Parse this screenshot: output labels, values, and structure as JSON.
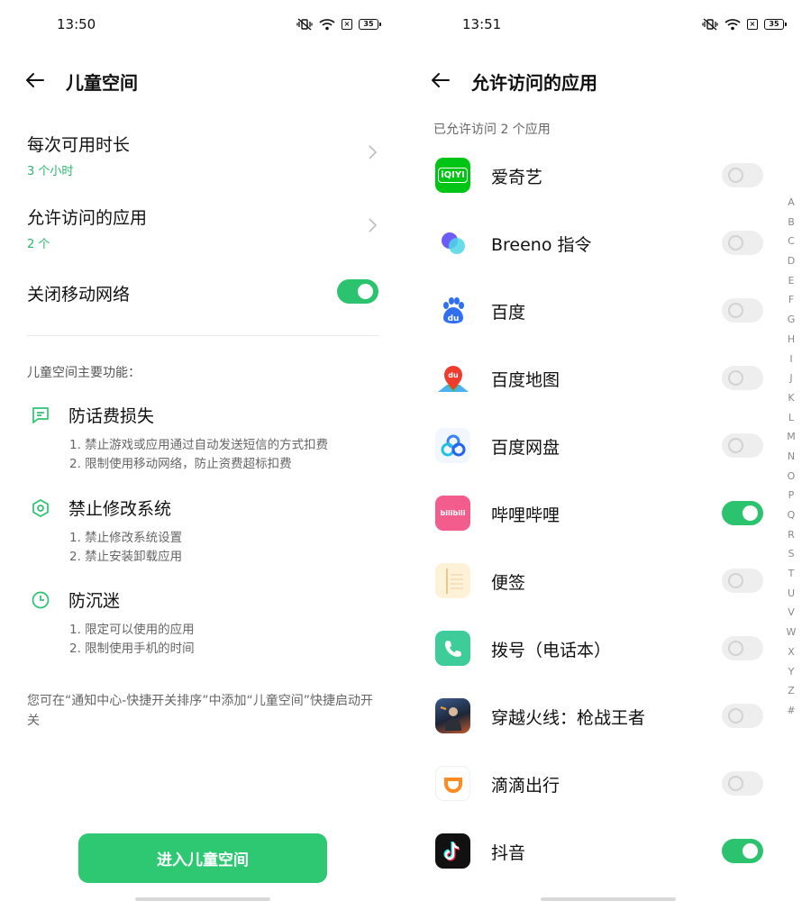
{
  "left": {
    "status_time": "13:50",
    "battery": "35",
    "title": "儿童空间",
    "settings": [
      {
        "title": "每次可用时长",
        "sub": "3 个小时"
      },
      {
        "title": "允许访问的应用",
        "sub": "2 个"
      }
    ],
    "network_toggle": {
      "title": "关闭移动网络",
      "on": true
    },
    "features_heading": "儿童空间主要功能：",
    "features": [
      {
        "icon": "message-icon",
        "title": "防话费损失",
        "lines": [
          "1. 禁止游戏或应用通过自动发送短信的方式扣费",
          "2. 限制使用移动网络，防止资费超标扣费"
        ]
      },
      {
        "icon": "shield-hexagon-icon",
        "title": "禁止修改系统",
        "lines": [
          "1. 禁止修改系统设置",
          "2. 禁止安装卸载应用"
        ]
      },
      {
        "icon": "clock-icon",
        "title": "防沉迷",
        "lines": [
          "1. 限定可以使用的应用",
          "2. 限制使用手机的时间"
        ]
      }
    ],
    "note": "您可在“通知中心-快捷开关排序”中添加“儿童空间”快捷启动开关",
    "enter_button": "进入儿童空间"
  },
  "right": {
    "status_time": "13:51",
    "battery": "35",
    "title": "允许访问的应用",
    "count_label": "已允许访问 2 个应用",
    "apps": [
      {
        "name": "爱奇艺",
        "icon": "iqiyi-icon",
        "icon_text": "iQIYI",
        "enabled": false
      },
      {
        "name": "Breeno 指令",
        "icon": "breeno-icon",
        "enabled": false
      },
      {
        "name": "百度",
        "icon": "baidu-icon",
        "icon_text": "du",
        "enabled": false
      },
      {
        "name": "百度地图",
        "icon": "baidu-map-icon",
        "icon_text": "du",
        "enabled": false
      },
      {
        "name": "百度网盘",
        "icon": "baidu-netdisk-icon",
        "enabled": false
      },
      {
        "name": "哔哩哔哩",
        "icon": "bilibili-icon",
        "icon_text": "bilibili",
        "enabled": true
      },
      {
        "name": "便签",
        "icon": "notes-icon",
        "enabled": false
      },
      {
        "name": "拨号（电话本）",
        "icon": "phone-icon",
        "enabled": false
      },
      {
        "name": "穿越火线：枪战王者",
        "icon": "crossfire-icon",
        "enabled": false
      },
      {
        "name": "滴滴出行",
        "icon": "didi-icon",
        "enabled": false
      },
      {
        "name": "抖音",
        "icon": "douyin-icon",
        "enabled": true
      }
    ],
    "alphabet": [
      "A",
      "B",
      "C",
      "D",
      "E",
      "F",
      "G",
      "H",
      "I",
      "J",
      "K",
      "L",
      "M",
      "N",
      "O",
      "P",
      "Q",
      "R",
      "S",
      "T",
      "U",
      "V",
      "W",
      "X",
      "Y",
      "Z",
      "#"
    ]
  },
  "colors": {
    "accent": "#2cc36f",
    "toggle_off": "#eeeeee",
    "sub_text": "#27b86a"
  }
}
